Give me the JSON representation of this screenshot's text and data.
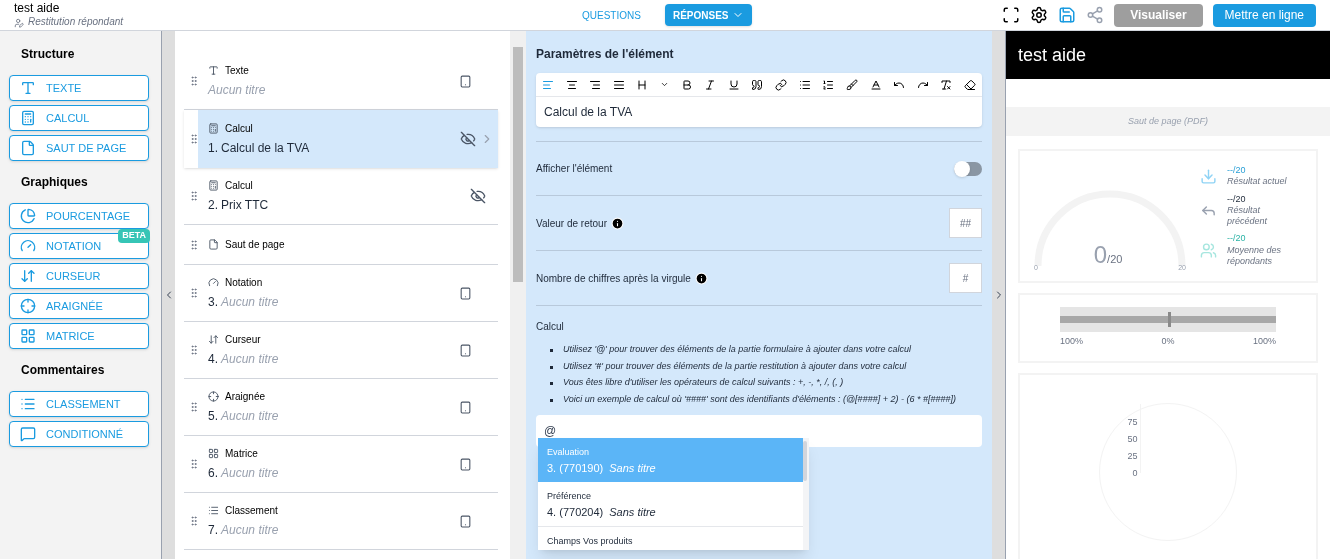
{
  "header": {
    "title": "test aide",
    "subtitle": "Restitution répondant",
    "tabs": [
      {
        "label": "QUESTIONS",
        "selected": false,
        "dropdown": false
      },
      {
        "label": "RÉPONSES",
        "selected": true,
        "dropdown": true
      }
    ],
    "tools": [
      {
        "kind": "fullscreen",
        "disabled": false
      },
      {
        "kind": "settings",
        "disabled": false
      },
      {
        "kind": "save",
        "disabled": false
      },
      {
        "kind": "share",
        "disabled": true
      }
    ],
    "buttons": [
      {
        "label": "Visualiser",
        "kind": "secondary"
      },
      {
        "label": "Mettre en ligne",
        "kind": "primary"
      }
    ]
  },
  "sidebar": {
    "sections": [
      {
        "title": "Structure",
        "items": [
          {
            "label": "TEXTE",
            "kind": "text"
          },
          {
            "label": "CALCUL",
            "kind": "calc"
          },
          {
            "label": "SAUT DE PAGE",
            "kind": "page"
          }
        ]
      },
      {
        "title": "Graphiques",
        "items": [
          {
            "label": "POURCENTAGE",
            "kind": "pie"
          },
          {
            "label": "NOTATION",
            "kind": "gauge",
            "badge": "BETA"
          },
          {
            "label": "CURSEUR",
            "kind": "slider"
          },
          {
            "label": "ARAIGNÉE",
            "kind": "spider"
          },
          {
            "label": "MATRICE",
            "kind": "matrix"
          }
        ]
      },
      {
        "title": "Commentaires",
        "items": [
          {
            "label": "CLASSEMENT",
            "kind": "list"
          },
          {
            "label": "CONDITIONNÉ",
            "kind": "comment"
          }
        ]
      }
    ]
  },
  "elements": [
    {
      "kind": "text",
      "type": "Texte",
      "title": "Aucun titre",
      "untitled": true,
      "selected": false,
      "hidden": false,
      "mobile": true
    },
    {
      "kind": "calc",
      "type": "Calcul",
      "number": "1.",
      "title": "Calcul de la TVA",
      "untitled": false,
      "selected": true,
      "hidden": true,
      "mobile": false
    },
    {
      "kind": "calc",
      "type": "Calcul",
      "number": "2.",
      "title": "Prix TTC",
      "untitled": false,
      "selected": false,
      "hidden": true,
      "mobile": false
    },
    {
      "kind": "page",
      "type": "Saut de page",
      "selected": false,
      "hidden": false,
      "mobile": false
    },
    {
      "kind": "gauge",
      "type": "Notation",
      "number": "3.",
      "title": "Aucun titre",
      "untitled": true,
      "selected": false,
      "hidden": false,
      "mobile": true
    },
    {
      "kind": "slider",
      "type": "Curseur",
      "number": "4.",
      "title": "Aucun titre",
      "untitled": true,
      "selected": false,
      "hidden": false,
      "mobile": true
    },
    {
      "kind": "spider",
      "type": "Araignée",
      "number": "5.",
      "title": "Aucun titre",
      "untitled": true,
      "selected": false,
      "hidden": false,
      "mobile": true
    },
    {
      "kind": "matrix",
      "type": "Matrice",
      "number": "6.",
      "title": "Aucun titre",
      "untitled": true,
      "selected": false,
      "hidden": false,
      "mobile": true
    },
    {
      "kind": "list",
      "type": "Classement",
      "number": "7.",
      "title": "Aucun titre",
      "untitled": true,
      "selected": false,
      "hidden": false,
      "mobile": true
    }
  ],
  "settings": {
    "title": "Paramètres de l'élément",
    "toolbar": [
      {
        "kind": "align-left",
        "selected": true
      },
      {
        "kind": "align-center",
        "selected": false
      },
      {
        "kind": "align-right",
        "selected": false
      },
      {
        "kind": "align-justify",
        "selected": false
      },
      {
        "kind": "font-size",
        "selected": false
      },
      {
        "kind": "caret",
        "selected": false
      },
      {
        "kind": "bold",
        "selected": false
      },
      {
        "kind": "italic",
        "selected": false
      },
      {
        "kind": "underline",
        "selected": false
      },
      {
        "kind": "quote",
        "selected": false
      },
      {
        "kind": "link",
        "selected": false
      },
      {
        "kind": "bullets",
        "selected": false
      },
      {
        "kind": "numbers",
        "selected": false
      },
      {
        "kind": "brush",
        "selected": false
      },
      {
        "kind": "ligature",
        "selected": false
      },
      {
        "kind": "undo",
        "selected": false
      },
      {
        "kind": "redo",
        "selected": false
      },
      {
        "kind": "clear-format",
        "selected": false
      },
      {
        "kind": "eraser",
        "selected": false
      }
    ],
    "editor_text": "Calcul de la TVA",
    "toggle": {
      "label": "Afficher l'élément",
      "on": false
    },
    "fields": [
      {
        "label": "Valeur de retour",
        "placeholder": "##"
      },
      {
        "label": "Nombre de chiffres après la virgule",
        "placeholder": "#"
      }
    ],
    "calc_label": "Calcul",
    "hints": [
      "Utilisez '**@**' pour trouver des éléments de la partie formulaire à ajouter dans votre calcul",
      "Utilisez '**#**' pour trouver des éléments de la partie restitution à ajouter dans votre calcul",
      "Vous êtes libre d'utiliser les opérateurs de calcul suivants : +, -, *, /, (, )",
      "Voici un exemple de calcul où '####' sont des identifiants d'éléments : (@[####] + 2) - (6 * #[####])"
    ],
    "calc_value": "@",
    "suggestions": [
      {
        "category": "Evaluation",
        "number": "3. (770190)",
        "title": "Sans titre",
        "selected": true
      },
      {
        "category": "Préférence",
        "number": "4. (770204)",
        "title": "Sans titre",
        "selected": false
      },
      {
        "category": "Champs   Vos produits",
        "selected": false
      }
    ]
  },
  "preview": {
    "title": "test aide",
    "page_break": "Saut de page (PDF)",
    "gauge": {
      "value": "0",
      "max": "/20",
      "min_label": "0",
      "max_label": "20"
    },
    "stats": [
      {
        "value": "--/20",
        "label": "Résultat actuel",
        "kind": "current"
      },
      {
        "value": "--/20",
        "label": "Résultat précédent",
        "kind": "previous"
      },
      {
        "value": "--/20",
        "label": "Moyenne des répondants",
        "kind": "average"
      }
    ],
    "cursor": {
      "labels": [
        "100%",
        "0%",
        "100%"
      ],
      "level": 0.5
    },
    "radar_ticks": [
      "75",
      "50",
      "25",
      "0"
    ]
  }
}
